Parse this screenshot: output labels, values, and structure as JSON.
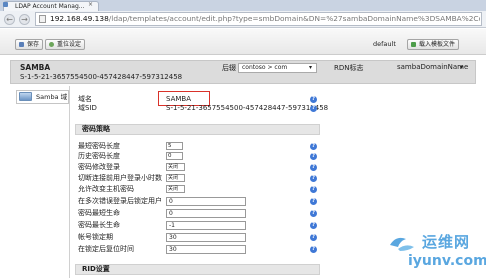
{
  "browser": {
    "tab_title": "LDAP Account Manag...",
    "tab_close": "×",
    "back": "←",
    "forward": "→",
    "url_host": "192.168.49.138",
    "url_rest": "/ldap/templates/account/edit.php?type=smbDomain&DN=%27sambaDomainName%3DSAMBA%2Cdc%3Dco"
  },
  "toolbar": {
    "save_label": "保存",
    "reset_label": "重位设定",
    "default_label": "default",
    "import_label": "载入模板文件"
  },
  "header": {
    "title": "SAMBA",
    "subtitle": "S-1-5-21-3657554500-457428447-597312458",
    "suffix_label": "后辍",
    "suffix_value": "contoso > com",
    "rdn_label": "RDN标志",
    "rdn_value": "sambaDomainName"
  },
  "sidebar": {
    "tab_label": "Samba 域"
  },
  "form": {
    "domain_label": "域名",
    "domain_value": "SAMBA",
    "sid_label": "域SID",
    "sid_value": "S-1-5-21-3657554500-457428447-597312458",
    "password_policy_title": "密码策略",
    "min_pw_length_label": "最短密码长度",
    "min_pw_length_value": "5",
    "history_length_label": "历史密码长度",
    "history_length_value": "0",
    "pw_change_logon_label": "密码修改登录",
    "pw_change_logon_value": "关闭",
    "disconnect_label": "切断连接前用户登录小时数",
    "disconnect_value": "关闭",
    "machine_pw_label": "允许改变主机密码",
    "machine_pw_value": "关闭",
    "lockout_threshold_label": "在多次错误登录后锁定用户",
    "lockout_threshold_value": "0",
    "min_pw_age_label": "密码最短生命",
    "min_pw_age_value": "0",
    "max_pw_age_label": "密码最长生命",
    "max_pw_age_value": "-1",
    "lockout_duration_label": "帐号锁定期",
    "lockout_duration_value": "30",
    "reset_lockout_label": "在锁定后复位时间",
    "reset_lockout_value": "30",
    "rid_settings_title": "RID设置"
  },
  "watermark": {
    "cn": "运维网",
    "url": "iyunv.com"
  },
  "colors": {
    "help": "#3f78d6",
    "highlight": "#d9322a",
    "watermark": "#5aa7e0"
  }
}
